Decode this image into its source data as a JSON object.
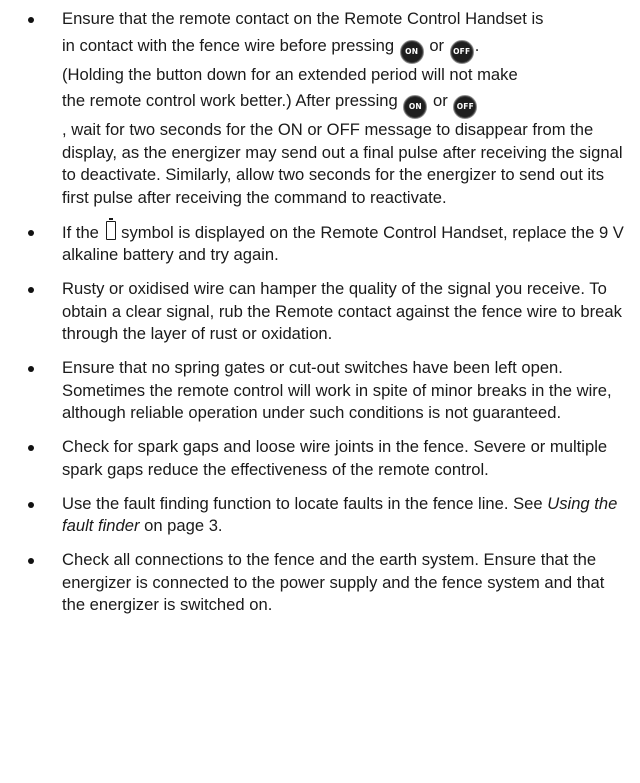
{
  "icons": {
    "on_button": "ON",
    "off_button": "OFF",
    "battery": "battery-low-icon"
  },
  "items": [
    {
      "line1": "Ensure that the remote contact on the Remote Control Handset is",
      "line2_before": "in contact with the fence wire before pressing",
      "or1": "or",
      "line2_end": ".",
      "line3": "(Holding the button down for an extended period will not make",
      "line4_before": "the remote control work better.)  After pressing",
      "or2": "or",
      "rest": ", wait for two seconds for the ON or OFF message to disappear from the display, as the energizer may send out a final pulse after receiving the signal to deactivate.  Similarly, allow two seconds for the energizer to send out its first pulse after receiving the command to reactivate."
    },
    {
      "before": "If the",
      "after": "symbol is displayed on the Remote Control Handset, replace the 9 V alkaline battery and try again."
    },
    {
      "text": "Rusty or oxidised wire can hamper the quality of the signal you receive.  To obtain a clear signal, rub the Remote contact against the fence wire to break through the layer of rust or oxidation."
    },
    {
      "text": "Ensure that no spring gates or cut-out switches have been left open.  Sometimes the remote control will work in spite of minor breaks in the wire, although reliable operation under such conditions is not guaranteed."
    },
    {
      "text": "Check for spark gaps and loose wire joints in the fence. Severe or multiple spark gaps reduce the effectiveness of the remote control."
    },
    {
      "before": "Use the fault finding function to locate faults in the fence line. See",
      "link": "Using the fault finder",
      "after": "on page 3."
    },
    {
      "text": "Check all connections to the fence and the earth system. Ensure that the energizer is connected to the power supply and the fence system and that the energizer is switched on."
    }
  ]
}
